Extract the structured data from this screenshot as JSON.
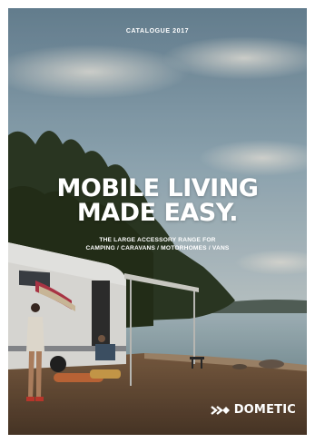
{
  "cover": {
    "catalogue_label": "CATALOGUE 2017",
    "headline_line1": "MOBILE LIVING",
    "headline_line2": "MADE EASY.",
    "subtitle_line1": "THE LARGE ACCESSORY RANGE FOR",
    "subtitle_line2": "CAMPING / CARAVANS / MOTORHOMES / VANS",
    "brand_name": "DOMETIC",
    "brand_icon": "dometic-logo-icon"
  },
  "colors": {
    "sky_top": "#8ea8b8",
    "sky_mid": "#b9c7cc",
    "forest": "#2f3a24",
    "lake": "#9fb2b8",
    "sand": "#8a6a4c",
    "text": "#ffffff"
  }
}
